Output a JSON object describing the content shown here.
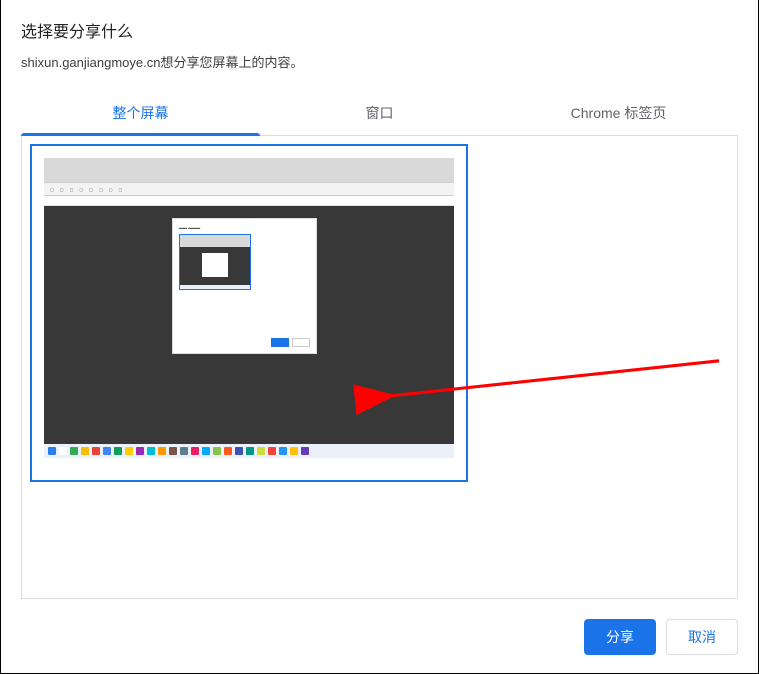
{
  "dialog": {
    "title": "选择要分享什么",
    "subtitle": "shixun.ganjiangmoye.cn想分享您屏幕上的内容。"
  },
  "tabs": {
    "entire_screen": "整个屏幕",
    "window": "窗口",
    "chrome_tab": "Chrome 标签页",
    "active_index": 0
  },
  "thumbnail": {
    "selected": true,
    "represents": "desktop-preview"
  },
  "buttons": {
    "share": "分享",
    "cancel": "取消"
  },
  "colors": {
    "accent": "#1a73e8",
    "arrow": "#ff0000"
  },
  "mini_taskbar_icons": [
    "#2b7de9",
    "#ffffff",
    "#34a853",
    "#fbbc04",
    "#ea4335",
    "#4285f4",
    "#0f9d58",
    "#ffcc00",
    "#9c27b0",
    "#00bcd4",
    "#ff9800",
    "#795548",
    "#607d8b",
    "#e91e63",
    "#03a9f4",
    "#8bc34a",
    "#ff5722",
    "#3f51b5",
    "#009688",
    "#cddc39",
    "#f44336",
    "#2196f3",
    "#ffc107",
    "#673ab7"
  ]
}
